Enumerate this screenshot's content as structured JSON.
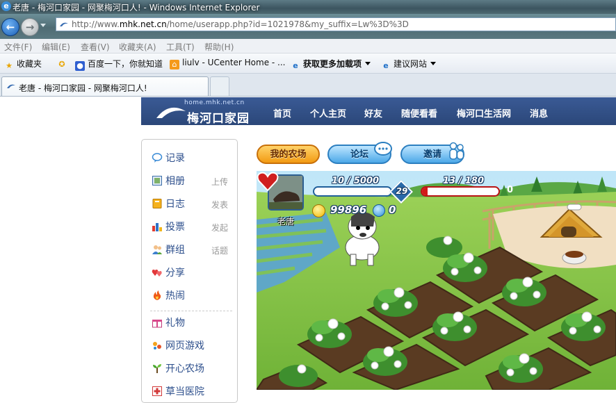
{
  "window": {
    "title": "老唐 - 梅河口家园 - 网聚梅河口人! - Windows Internet Explorer"
  },
  "address_bar": {
    "url_prefix": "http://www.",
    "url_domain": "mhk.net.cn",
    "url_rest": "/home/userapp.php?id=1021978&my_suffix=Lw%3D%3D"
  },
  "menu": {
    "items": [
      "文件(F)",
      "编辑(E)",
      "查看(V)",
      "收藏夹(A)",
      "工具(T)",
      "帮助(H)"
    ]
  },
  "favorites_bar": {
    "favorites_label": "收藏夹",
    "links": [
      "百度一下，你就知道",
      "liulv - UCenter Home - ...",
      "获取更多加载项",
      "建议网站"
    ]
  },
  "tabs": {
    "active_tab": "老唐 - 梅河口家园 - 网聚梅河口人!"
  },
  "site": {
    "logo_domain": "home.mhk.net.cn",
    "logo_name": "梅河口家园",
    "nav": [
      "首页",
      "个人主页",
      "好友",
      "随便看看",
      "梅河口生活网",
      "消息"
    ]
  },
  "sidebar": {
    "items": [
      {
        "label": "记录",
        "action": ""
      },
      {
        "label": "相册",
        "action": "上传"
      },
      {
        "label": "日志",
        "action": "发表"
      },
      {
        "label": "投票",
        "action": "发起"
      },
      {
        "label": "群组",
        "action": "话题"
      },
      {
        "label": "分享",
        "action": ""
      },
      {
        "label": "热闹",
        "action": ""
      },
      {
        "label": "礼物",
        "action": ""
      },
      {
        "label": "网页游戏",
        "action": ""
      },
      {
        "label": "开心农场",
        "action": ""
      },
      {
        "label": "草当医院",
        "action": ""
      }
    ]
  },
  "app_buttons": {
    "my_farm": "我的农场",
    "forum": "论坛",
    "invite": "邀请"
  },
  "game": {
    "player_name": "老唐",
    "experience": "10 / 5000",
    "experience_fraction": 0.002,
    "level": "29",
    "health": "13 / 180",
    "health_fraction": 0.072,
    "hearts": "0",
    "coins": "99896",
    "gems": "0"
  },
  "colors": {
    "header_bg": "#2f4d84",
    "link_blue": "#2d4f8c",
    "grass": "#86c247",
    "soil": "#5a3b22"
  }
}
